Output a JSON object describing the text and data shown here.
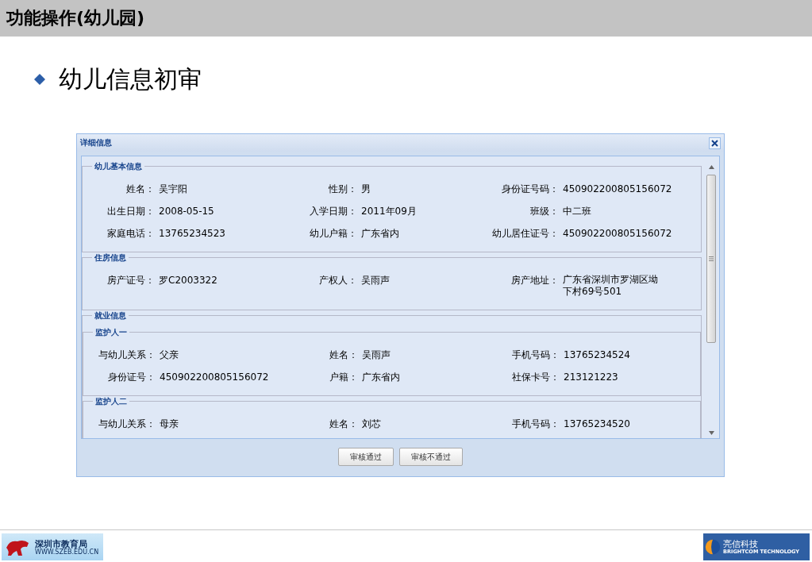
{
  "slide_title": "功能操作(幼儿园)",
  "heading": "幼儿信息初审",
  "dialog": {
    "title": "详细信息",
    "sections": [
      {
        "title": "幼儿基本信息",
        "fields": [
          {
            "label": "姓名：",
            "value": "吴宇阳"
          },
          {
            "label": "性别：",
            "value": "男"
          },
          {
            "label": "身份证号码：",
            "value": "450902200805156072"
          },
          {
            "label": "出生日期：",
            "value": "2008-05-15"
          },
          {
            "label": "入学日期：",
            "value": "2011年09月"
          },
          {
            "label": "班级：",
            "value": "中二班"
          },
          {
            "label": "家庭电话：",
            "value": "13765234523"
          },
          {
            "label": "幼儿户籍：",
            "value": "广东省内"
          },
          {
            "label": "幼儿居住证号：",
            "value": "450902200805156072"
          }
        ]
      },
      {
        "title": "住房信息",
        "fields": [
          {
            "label": "房产证号：",
            "value": "罗C2003322"
          },
          {
            "label": "产权人：",
            "value": "吴雨声"
          },
          {
            "label": "房产地址：",
            "value": "广东省深圳市罗湖区坳下村69号501"
          }
        ]
      },
      {
        "title": "就业信息",
        "subsections": [
          {
            "title": "监护人一",
            "fields": [
              {
                "label": "与幼儿关系：",
                "value": "父亲"
              },
              {
                "label": "姓名：",
                "value": "吴雨声"
              },
              {
                "label": "手机号码：",
                "value": "13765234524"
              },
              {
                "label": "身份证号：",
                "value": "450902200805156072"
              },
              {
                "label": "户籍：",
                "value": "广东省内"
              },
              {
                "label": "社保卡号：",
                "value": "213121223"
              }
            ]
          },
          {
            "title": "监护人二",
            "fields": [
              {
                "label": "与幼儿关系：",
                "value": "母亲"
              },
              {
                "label": "姓名：",
                "value": "刘芯"
              },
              {
                "label": "手机号码：",
                "value": "13765234520"
              }
            ]
          }
        ]
      }
    ],
    "buttons": [
      "审核通过",
      "审核不通过"
    ]
  },
  "footer": {
    "left_logo": {
      "name": "深圳市教育局",
      "url": "WWW.SZEB.EDU.CN"
    },
    "right_logo": {
      "name": "亮信科技",
      "tagline": "BRIGHTCOM TECHNOLOGY"
    }
  }
}
